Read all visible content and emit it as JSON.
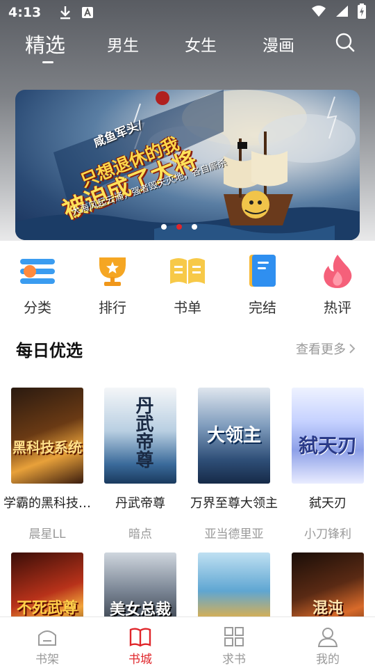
{
  "status_bar": {
    "time": "4:13",
    "icons": [
      "download-icon",
      "app-badge-icon",
      "wifi-icon",
      "signal-icon",
      "battery-charging-icon"
    ]
  },
  "top_tabs": [
    {
      "label": "精选",
      "active": true
    },
    {
      "label": "男生",
      "active": false
    },
    {
      "label": "女生",
      "active": false
    },
    {
      "label": "漫画",
      "active": false
    }
  ],
  "banner": {
    "line1": "咸鱼军头/",
    "line2": "只想退休的我",
    "line3": "被迫成了大将",
    "line4": "大海风起云涌，强者毁天灭地，各自厮杀",
    "dots": 3,
    "active_dot": 2
  },
  "categories": [
    {
      "label": "分类",
      "icon": "list-icon",
      "color": "#3a9cf0"
    },
    {
      "label": "排行",
      "icon": "trophy-icon",
      "color": "#f5a623"
    },
    {
      "label": "书单",
      "icon": "open-book-icon",
      "color": "#f7c948"
    },
    {
      "label": "完结",
      "icon": "notebook-icon",
      "color": "#2f8ff0"
    },
    {
      "label": "热评",
      "icon": "flame-icon",
      "color": "#f5607a"
    }
  ],
  "daily": {
    "title": "每日优选",
    "more": "查看更多"
  },
  "books_row1": [
    {
      "title": "学霸的黑科技…",
      "author": "晨星LL",
      "cover_text": "黑科技系统"
    },
    {
      "title": "丹武帝尊",
      "author": "暗点",
      "cover_text": "丹武帝尊"
    },
    {
      "title": "万界至尊大领主",
      "author": "亚当德里亚",
      "cover_text": "大领主"
    },
    {
      "title": "弑天刃",
      "author": "小刀锋利",
      "cover_text": "弑天刃"
    }
  ],
  "books_row2": [
    {
      "cover_text": "不死武尊"
    },
    {
      "cover_text": "美女总裁"
    },
    {
      "cover_text": ""
    },
    {
      "cover_text": "混沌"
    }
  ],
  "bottom_nav": [
    {
      "label": "书架",
      "icon": "shelf-icon",
      "active": false
    },
    {
      "label": "书城",
      "icon": "book-city-icon",
      "active": true
    },
    {
      "label": "求书",
      "icon": "grid-icon",
      "active": false
    },
    {
      "label": "我的",
      "icon": "user-icon",
      "active": false
    }
  ],
  "colors": {
    "accent": "#e0262b",
    "muted": "#999999"
  }
}
